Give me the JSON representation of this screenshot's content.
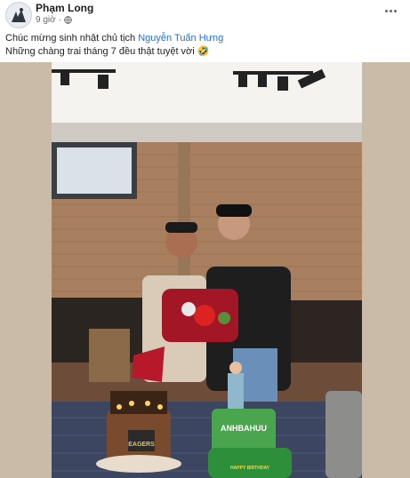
{
  "post": {
    "author": "Phạm Long",
    "time": "9 giờ",
    "dot": "·",
    "line1_prefix": "Chúc mừng sinh nhật chủ tịch ",
    "line1_link": "Nguyễn Tuấn Hưng",
    "line2": "Những chàng trai tháng 7 đều thật tuyệt vời 🤣"
  },
  "photo": {
    "cake_left_text": "EAGERS",
    "cake_right_text": "ANHBAHUU",
    "cake_right_bottom": "HAPPY BIRTHDAY"
  },
  "colors": {
    "link": "#216fdb",
    "brick": "#a07858",
    "floor": "#6b4b3a"
  }
}
